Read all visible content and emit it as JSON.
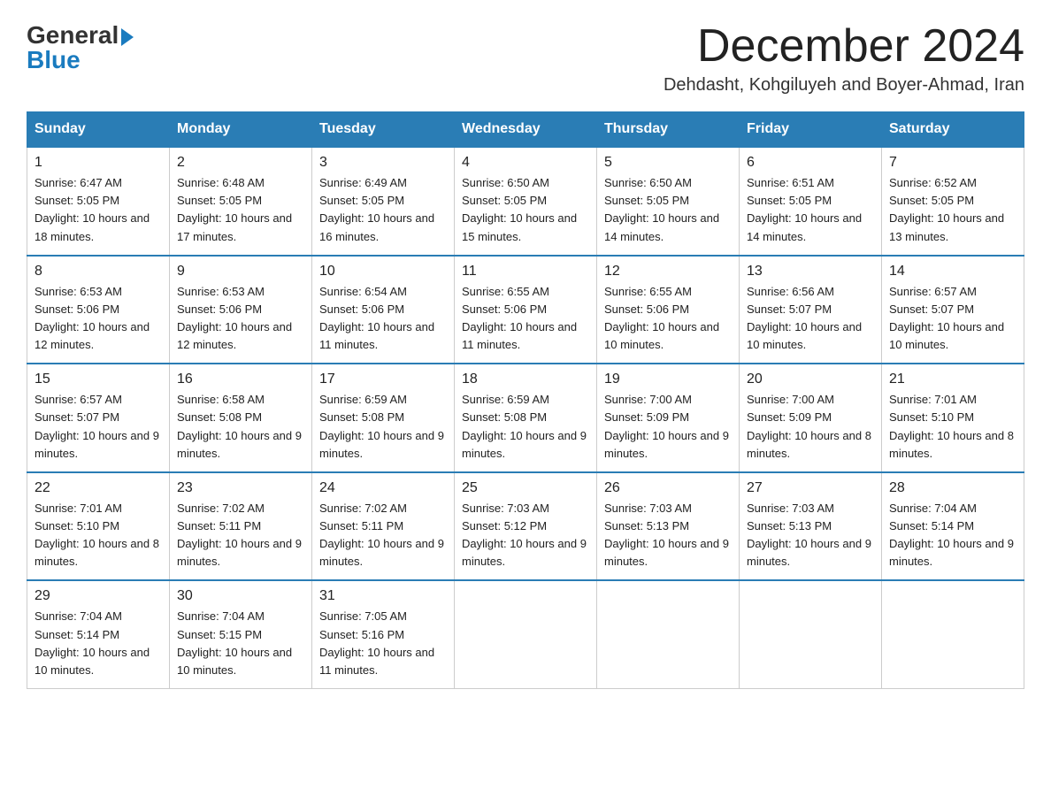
{
  "header": {
    "logo": {
      "general": "General",
      "blue": "Blue"
    },
    "title": "December 2024",
    "subtitle": "Dehdasht, Kohgiluyeh and Boyer-Ahmad, Iran"
  },
  "weekdays": [
    "Sunday",
    "Monday",
    "Tuesday",
    "Wednesday",
    "Thursday",
    "Friday",
    "Saturday"
  ],
  "weeks": [
    [
      {
        "day": "1",
        "sunrise": "Sunrise: 6:47 AM",
        "sunset": "Sunset: 5:05 PM",
        "daylight": "Daylight: 10 hours and 18 minutes."
      },
      {
        "day": "2",
        "sunrise": "Sunrise: 6:48 AM",
        "sunset": "Sunset: 5:05 PM",
        "daylight": "Daylight: 10 hours and 17 minutes."
      },
      {
        "day": "3",
        "sunrise": "Sunrise: 6:49 AM",
        "sunset": "Sunset: 5:05 PM",
        "daylight": "Daylight: 10 hours and 16 minutes."
      },
      {
        "day": "4",
        "sunrise": "Sunrise: 6:50 AM",
        "sunset": "Sunset: 5:05 PM",
        "daylight": "Daylight: 10 hours and 15 minutes."
      },
      {
        "day": "5",
        "sunrise": "Sunrise: 6:50 AM",
        "sunset": "Sunset: 5:05 PM",
        "daylight": "Daylight: 10 hours and 14 minutes."
      },
      {
        "day": "6",
        "sunrise": "Sunrise: 6:51 AM",
        "sunset": "Sunset: 5:05 PM",
        "daylight": "Daylight: 10 hours and 14 minutes."
      },
      {
        "day": "7",
        "sunrise": "Sunrise: 6:52 AM",
        "sunset": "Sunset: 5:05 PM",
        "daylight": "Daylight: 10 hours and 13 minutes."
      }
    ],
    [
      {
        "day": "8",
        "sunrise": "Sunrise: 6:53 AM",
        "sunset": "Sunset: 5:06 PM",
        "daylight": "Daylight: 10 hours and 12 minutes."
      },
      {
        "day": "9",
        "sunrise": "Sunrise: 6:53 AM",
        "sunset": "Sunset: 5:06 PM",
        "daylight": "Daylight: 10 hours and 12 minutes."
      },
      {
        "day": "10",
        "sunrise": "Sunrise: 6:54 AM",
        "sunset": "Sunset: 5:06 PM",
        "daylight": "Daylight: 10 hours and 11 minutes."
      },
      {
        "day": "11",
        "sunrise": "Sunrise: 6:55 AM",
        "sunset": "Sunset: 5:06 PM",
        "daylight": "Daylight: 10 hours and 11 minutes."
      },
      {
        "day": "12",
        "sunrise": "Sunrise: 6:55 AM",
        "sunset": "Sunset: 5:06 PM",
        "daylight": "Daylight: 10 hours and 10 minutes."
      },
      {
        "day": "13",
        "sunrise": "Sunrise: 6:56 AM",
        "sunset": "Sunset: 5:07 PM",
        "daylight": "Daylight: 10 hours and 10 minutes."
      },
      {
        "day": "14",
        "sunrise": "Sunrise: 6:57 AM",
        "sunset": "Sunset: 5:07 PM",
        "daylight": "Daylight: 10 hours and 10 minutes."
      }
    ],
    [
      {
        "day": "15",
        "sunrise": "Sunrise: 6:57 AM",
        "sunset": "Sunset: 5:07 PM",
        "daylight": "Daylight: 10 hours and 9 minutes."
      },
      {
        "day": "16",
        "sunrise": "Sunrise: 6:58 AM",
        "sunset": "Sunset: 5:08 PM",
        "daylight": "Daylight: 10 hours and 9 minutes."
      },
      {
        "day": "17",
        "sunrise": "Sunrise: 6:59 AM",
        "sunset": "Sunset: 5:08 PM",
        "daylight": "Daylight: 10 hours and 9 minutes."
      },
      {
        "day": "18",
        "sunrise": "Sunrise: 6:59 AM",
        "sunset": "Sunset: 5:08 PM",
        "daylight": "Daylight: 10 hours and 9 minutes."
      },
      {
        "day": "19",
        "sunrise": "Sunrise: 7:00 AM",
        "sunset": "Sunset: 5:09 PM",
        "daylight": "Daylight: 10 hours and 9 minutes."
      },
      {
        "day": "20",
        "sunrise": "Sunrise: 7:00 AM",
        "sunset": "Sunset: 5:09 PM",
        "daylight": "Daylight: 10 hours and 8 minutes."
      },
      {
        "day": "21",
        "sunrise": "Sunrise: 7:01 AM",
        "sunset": "Sunset: 5:10 PM",
        "daylight": "Daylight: 10 hours and 8 minutes."
      }
    ],
    [
      {
        "day": "22",
        "sunrise": "Sunrise: 7:01 AM",
        "sunset": "Sunset: 5:10 PM",
        "daylight": "Daylight: 10 hours and 8 minutes."
      },
      {
        "day": "23",
        "sunrise": "Sunrise: 7:02 AM",
        "sunset": "Sunset: 5:11 PM",
        "daylight": "Daylight: 10 hours and 9 minutes."
      },
      {
        "day": "24",
        "sunrise": "Sunrise: 7:02 AM",
        "sunset": "Sunset: 5:11 PM",
        "daylight": "Daylight: 10 hours and 9 minutes."
      },
      {
        "day": "25",
        "sunrise": "Sunrise: 7:03 AM",
        "sunset": "Sunset: 5:12 PM",
        "daylight": "Daylight: 10 hours and 9 minutes."
      },
      {
        "day": "26",
        "sunrise": "Sunrise: 7:03 AM",
        "sunset": "Sunset: 5:13 PM",
        "daylight": "Daylight: 10 hours and 9 minutes."
      },
      {
        "day": "27",
        "sunrise": "Sunrise: 7:03 AM",
        "sunset": "Sunset: 5:13 PM",
        "daylight": "Daylight: 10 hours and 9 minutes."
      },
      {
        "day": "28",
        "sunrise": "Sunrise: 7:04 AM",
        "sunset": "Sunset: 5:14 PM",
        "daylight": "Daylight: 10 hours and 9 minutes."
      }
    ],
    [
      {
        "day": "29",
        "sunrise": "Sunrise: 7:04 AM",
        "sunset": "Sunset: 5:14 PM",
        "daylight": "Daylight: 10 hours and 10 minutes."
      },
      {
        "day": "30",
        "sunrise": "Sunrise: 7:04 AM",
        "sunset": "Sunset: 5:15 PM",
        "daylight": "Daylight: 10 hours and 10 minutes."
      },
      {
        "day": "31",
        "sunrise": "Sunrise: 7:05 AM",
        "sunset": "Sunset: 5:16 PM",
        "daylight": "Daylight: 10 hours and 11 minutes."
      },
      null,
      null,
      null,
      null
    ]
  ]
}
